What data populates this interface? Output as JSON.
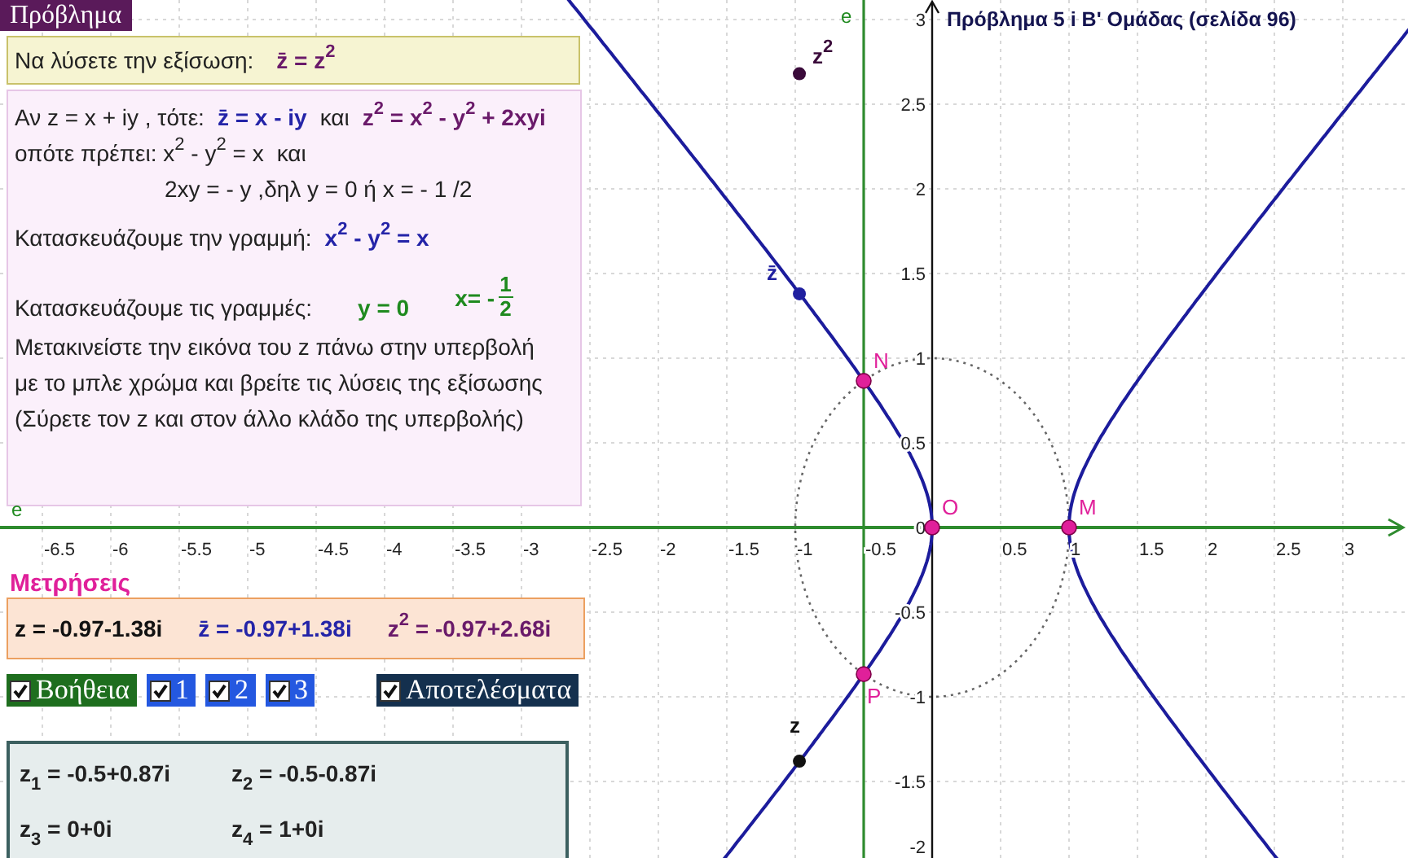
{
  "problem_tab": {
    "label": "Πρόβλημα"
  },
  "task_box": {
    "segments": [
      {
        "kind": "plain",
        "text": "Να λύσετε την εξίσωση:"
      },
      {
        "kind": "purple",
        "text": "z̄ = z$^{2}$"
      }
    ]
  },
  "help_box": {
    "lines": [
      {
        "kind": "row",
        "segments": [
          {
            "kind": "plain",
            "text": "Αν  z = x + iy , τότε:"
          },
          {
            "kind": "blue",
            "text": "z̄ = x - iy"
          },
          {
            "kind": "plain",
            "text": "και"
          },
          {
            "kind": "purple",
            "text": "z$^{2}$ = x$^{2}$ - y$^{2}$ + 2xyi"
          }
        ]
      },
      {
        "kind": "row",
        "segments": [
          {
            "kind": "plain",
            "text": "οπότε πρέπει:  x$^{2}$ - y$^{2}$ = x"
          },
          {
            "kind": "plain",
            "text": "και"
          }
        ]
      },
      {
        "kind": "indented",
        "segments": [
          {
            "kind": "plain",
            "text": "2xy = - y ,δηλ  y = 0  ή  x = - 1 /2"
          }
        ]
      },
      {
        "kind": "spaced",
        "segments": [
          {
            "kind": "plain",
            "text": "Κατασκευάζουμε την γραμμή:"
          },
          {
            "kind": "blue",
            "text": "x$^{2}$ - y$^{2}$ = x"
          }
        ]
      },
      {
        "kind": "spaced",
        "segments": [
          {
            "kind": "plain",
            "text": "Κατασκευάζουμε τις  γραμμές:"
          },
          {
            "kind": "green",
            "text": "y = 0"
          },
          {
            "kind": "fraction",
            "text": "x= -",
            "numerator": "1",
            "denominator": "2"
          }
        ]
      },
      {
        "kind": "row",
        "segments": [
          {
            "kind": "plain",
            "text": "Μετακινείστε την εικόνα του  z  πάνω στην υπερβολή"
          }
        ]
      },
      {
        "kind": "row",
        "segments": [
          {
            "kind": "plain",
            "text": "με το μπλε χρώμα και βρείτε τις λύσεις της εξίσωσης"
          }
        ]
      },
      {
        "kind": "row",
        "segments": [
          {
            "kind": "plain",
            "text": "(Σύρετε τον z και στον άλλο κλάδο της υπερβολής)"
          }
        ]
      }
    ]
  },
  "line_labels": [
    "e",
    "e"
  ],
  "measurements": {
    "title": "Μετρήσεις",
    "values": [
      {
        "kind": "plain",
        "text": "z = -0.97-1.38i"
      },
      {
        "kind": "blue",
        "text": "z̄ = -0.97+1.38i"
      },
      {
        "kind": "purple",
        "text": "z$^{2}$ = -0.97+2.68i"
      }
    ]
  },
  "checkboxes": [
    {
      "label": "Βοήθεια",
      "checked": true,
      "color": "#1e6e1e"
    },
    {
      "label": "1",
      "checked": true,
      "color": "#2458e0"
    },
    {
      "label": "2",
      "checked": true,
      "color": "#2458e0"
    },
    {
      "label": "3",
      "checked": true,
      "color": "#2458e0"
    },
    {
      "label": "Αποτελέσματα",
      "checked": true,
      "color": "#14304e"
    }
  ],
  "results": [
    [
      "z$_{1}$ = -0.5+0.87i",
      "z$_{2}$ = -0.5-0.87i"
    ],
    [
      "z$_{3}$ = 0+0i",
      "z$_{4}$ = 1+0i"
    ]
  ],
  "graph": {
    "title": "Πρόβλημα 5 i  Β'  Ομάδας (σελίδα 96)",
    "x_ticks": [
      "-6.5",
      "-6",
      "-5.5",
      "-5",
      "-4.5",
      "-4",
      "-3.5",
      "-3",
      "-2.5",
      "-2",
      "-1.5",
      "-1",
      "-0.5",
      "0.5",
      "1",
      "1.5",
      "2",
      "2.5",
      "3"
    ],
    "y_ticks": [
      "3",
      "2.5",
      "2",
      "1.5",
      "1",
      "0.5",
      "0",
      "-0.5",
      "-1",
      "-1.5",
      "-2"
    ],
    "points": [
      {
        "kind": "z2",
        "label": "z$^{2}$",
        "color": "#3a0a3a"
      },
      {
        "kind": "zbar",
        "label": "z̄",
        "color": "#2020a0"
      },
      {
        "kind": "N",
        "label": "N",
        "color": "#e0209a"
      },
      {
        "kind": "O",
        "label": "O",
        "color": "#e0209a"
      },
      {
        "kind": "M",
        "label": "M",
        "color": "#e0209a"
      },
      {
        "kind": "P",
        "label": "P",
        "color": "#e0209a"
      },
      {
        "kind": "z",
        "label": "z",
        "color": "#111111"
      }
    ]
  }
}
